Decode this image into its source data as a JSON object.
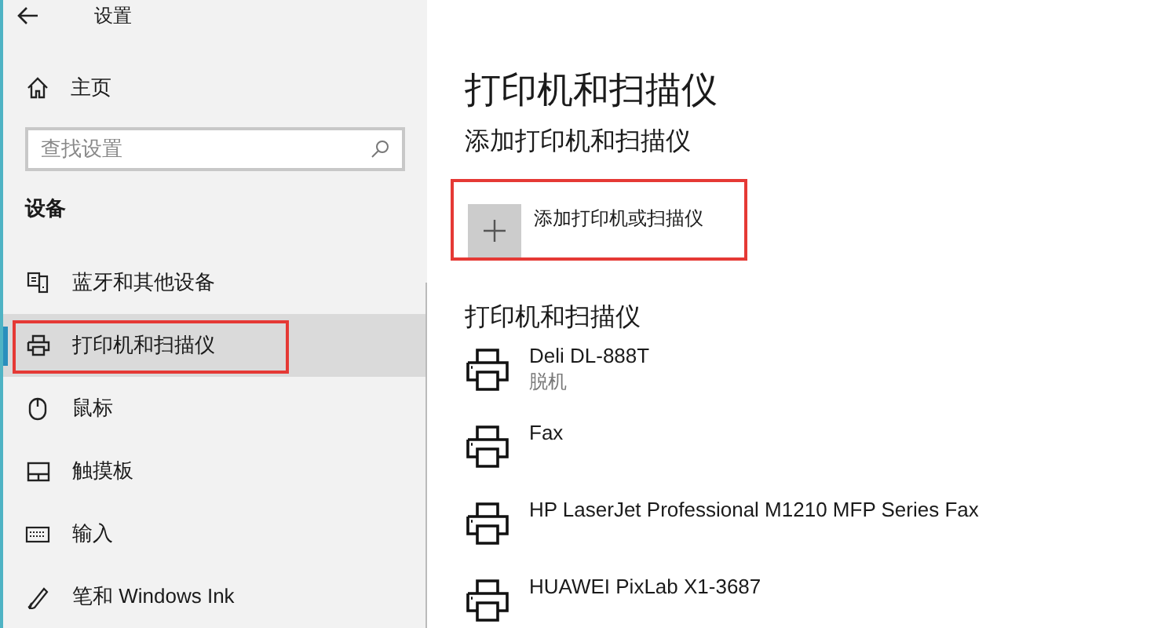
{
  "window": {
    "title": "设置"
  },
  "sidebar": {
    "home": "主页",
    "search": {
      "placeholder": "查找设置"
    },
    "section": "设备",
    "items": [
      {
        "label": "蓝牙和其他设备",
        "kind": "bluetooth",
        "selected": false,
        "annotated": false
      },
      {
        "label": "打印机和扫描仪",
        "kind": "printer",
        "selected": true,
        "annotated": true
      },
      {
        "label": "鼠标",
        "kind": "mouse",
        "selected": false,
        "annotated": false
      },
      {
        "label": "触摸板",
        "kind": "touchpad",
        "selected": false,
        "annotated": false
      },
      {
        "label": "输入",
        "kind": "keyboard",
        "selected": false,
        "annotated": false
      },
      {
        "label": "笔和 Windows Ink",
        "kind": "pen",
        "selected": false,
        "annotated": false
      }
    ]
  },
  "main": {
    "title": "打印机和扫描仪",
    "add_heading": "添加打印机和扫描仪",
    "add_button": {
      "label": "添加打印机或扫描仪",
      "annotated": true
    },
    "list_heading": "打印机和扫描仪",
    "printers": [
      {
        "name": "Deli DL-888T",
        "status": "脱机"
      },
      {
        "name": "Fax"
      },
      {
        "name": "HP LaserJet Professional M1210 MFP Series Fax"
      },
      {
        "name": "HUAWEI PixLab X1-3687"
      }
    ]
  }
}
